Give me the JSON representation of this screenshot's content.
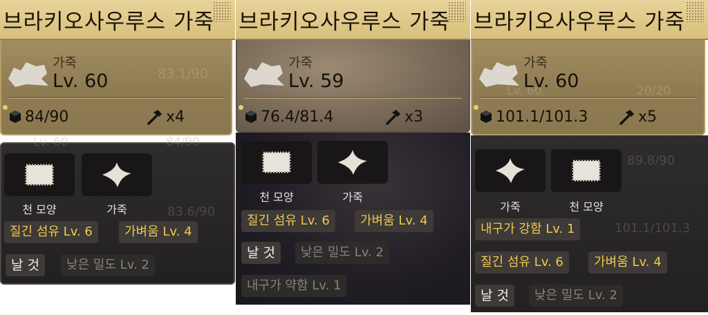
{
  "panels": [
    {
      "title": "브라키오사우루스 가죽",
      "category": "가죽",
      "level": "Lv. 60",
      "weight": "84/90",
      "hammer": "x4",
      "ghost_text": [
        "Lv. 60",
        "83.1/90",
        "Lv. 60",
        "84/90",
        "83.6/90"
      ],
      "slots": [
        {
          "icon": "cloth-pattern-icon",
          "label": "천 모양"
        },
        {
          "icon": "leather-icon",
          "label": "가죽"
        }
      ],
      "traits": [
        {
          "label": "질긴 섬유 Lv. 6",
          "style": "gold"
        },
        {
          "label": "가벼움 Lv. 4",
          "style": "gold"
        },
        {
          "label": "날 것",
          "style": "white"
        },
        {
          "label": "낮은 밀도 Lv. 2",
          "style": "gray"
        }
      ]
    },
    {
      "title": "브라키오사우루스 가죽",
      "category": "가죽",
      "level": "Lv. 59",
      "weight": "76.4/81.4",
      "hammer": "x3",
      "slots": [
        {
          "icon": "cloth-pattern-icon",
          "label": "천 모양"
        },
        {
          "icon": "leather-icon",
          "label": "가죽"
        }
      ],
      "traits": [
        {
          "label": "질긴 섬유 Lv. 6",
          "style": "gold"
        },
        {
          "label": "가벼움 Lv. 4",
          "style": "gold"
        },
        {
          "label": "날 것",
          "style": "white"
        },
        {
          "label": "낮은 밀도 Lv. 2",
          "style": "gray"
        },
        {
          "label": "내구가 약함 Lv. 1",
          "style": "gray"
        }
      ]
    },
    {
      "title": "브라키오사우루스 가죽",
      "category": "가죽",
      "level": "Lv. 60",
      "weight": "101.1/101.3",
      "hammer": "x5",
      "ghost_text": [
        "Lv. 60",
        "20/20",
        "89.8/90",
        "101.1/101.3"
      ],
      "slots": [
        {
          "icon": "leather-icon",
          "label": "가죽"
        },
        {
          "icon": "cloth-pattern-icon",
          "label": "천 모양"
        }
      ],
      "traits": [
        {
          "label": "내구가 강함 Lv. 1",
          "style": "gold"
        },
        {
          "label": "질긴 섬유 Lv. 6",
          "style": "gold"
        },
        {
          "label": "가벼움 Lv. 4",
          "style": "gold"
        },
        {
          "label": "날 것",
          "style": "white"
        },
        {
          "label": "낮은 밀도 Lv. 2",
          "style": "gray"
        }
      ]
    }
  ]
}
